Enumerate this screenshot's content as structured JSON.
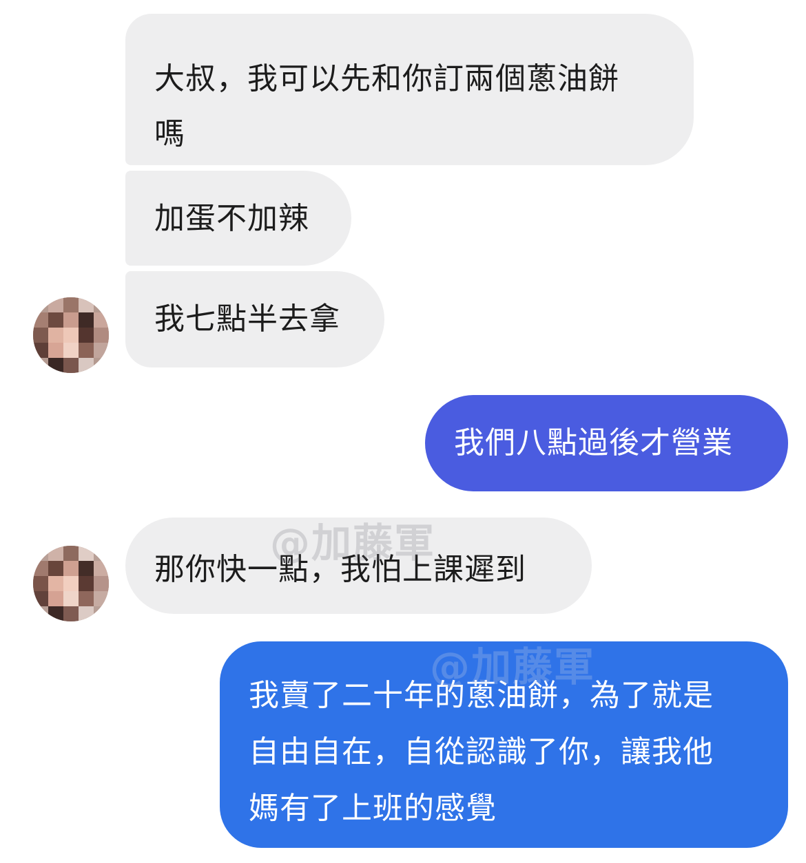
{
  "conversation": {
    "messages": [
      {
        "side": "incoming",
        "text": "大叔，我可以先和你訂兩個蔥油餅\n嗎"
      },
      {
        "side": "incoming",
        "text": "加蛋不加辣"
      },
      {
        "side": "incoming",
        "text": "我七點半去拿"
      },
      {
        "side": "outgoing",
        "text": "我們八點過後才營業"
      },
      {
        "side": "incoming",
        "text": "那你快一點，我怕上課遲到"
      },
      {
        "side": "outgoing",
        "text": "我賣了二十年的蔥油餅，為了就是\n自由自在，自從認識了你，讓我他\n媽有了上班的感覺"
      }
    ]
  },
  "watermark": {
    "text": "@加藤軍"
  },
  "colors": {
    "incoming_bubble": "#eeeeef",
    "outgoing_bubble_1": "#4a5ce0",
    "outgoing_bubble_2": "#2f73e8",
    "background": "#ffffff"
  },
  "icons": {
    "avatar": "pixelated-avatar"
  }
}
